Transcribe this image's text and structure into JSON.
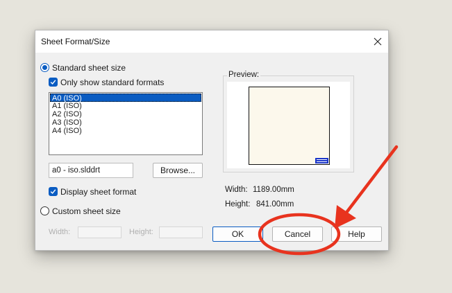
{
  "dialog": {
    "title": "Sheet Format/Size",
    "close_glyph": "✕"
  },
  "standard": {
    "radio_label": "Standard sheet size",
    "only_standard_label": "Only show standard formats",
    "formats": [
      "A0 (ISO)",
      "A1 (ISO)",
      "A2 (ISO)",
      "A3 (ISO)",
      "A4 (ISO)"
    ],
    "selected_format": "A0 (ISO)",
    "template_file": "a0 - iso.slddrt",
    "browse_label": "Browse...",
    "display_format_label": "Display sheet format"
  },
  "custom": {
    "radio_label": "Custom sheet size",
    "width_label": "Width:",
    "height_label": "Height:",
    "width_value": "",
    "height_value": ""
  },
  "preview": {
    "label": "Preview:",
    "width_label": "Width:",
    "width_value": "1189.00mm",
    "height_label": "Height:",
    "height_value": "841.00mm"
  },
  "buttons": {
    "ok": "OK",
    "cancel": "Cancel",
    "help": "Help"
  },
  "annotation": {
    "color": "#e8331e",
    "shape": "ellipse-with-arrow"
  }
}
